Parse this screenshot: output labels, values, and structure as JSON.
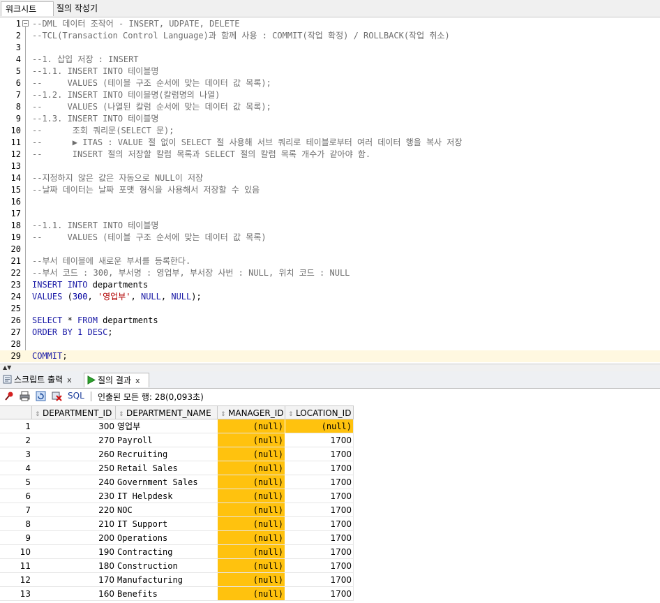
{
  "tabs": {
    "worksheet": "워크시트",
    "query_builder": "질의 작성기"
  },
  "editor": {
    "current_line": 29,
    "lines": [
      {
        "n": "1",
        "segs": [
          {
            "t": "--DML 데이터 조작어 - INSERT, UDPATE, DELETE",
            "c": "comment"
          }
        ]
      },
      {
        "n": "2",
        "segs": [
          {
            "t": "--TCL(Transaction Control Language)과 함께 사용 : COMMIT(작업 확정) / ROLLBACK(작업 취소)",
            "c": "comment"
          }
        ]
      },
      {
        "n": "3",
        "segs": []
      },
      {
        "n": "4",
        "segs": [
          {
            "t": "--1. 삽입 저장 : INSERT",
            "c": "comment"
          }
        ]
      },
      {
        "n": "5",
        "segs": [
          {
            "t": "--1.1. INSERT INTO 테이블명",
            "c": "comment"
          }
        ]
      },
      {
        "n": "6",
        "segs": [
          {
            "t": "--     VALUES (테이블 구조 순서에 맞는 데이터 값 목록);",
            "c": "comment"
          }
        ]
      },
      {
        "n": "7",
        "segs": [
          {
            "t": "--1.2. INSERT INTO 테이블명(칼럼명의 나열)",
            "c": "comment"
          }
        ]
      },
      {
        "n": "8",
        "segs": [
          {
            "t": "--     VALUES (나열된 칼럼 순서에 맞는 데이터 값 목록);",
            "c": "comment"
          }
        ]
      },
      {
        "n": "9",
        "segs": [
          {
            "t": "--1.3. INSERT INTO 테이블명",
            "c": "comment"
          }
        ]
      },
      {
        "n": "10",
        "segs": [
          {
            "t": "--      조회 쿼리문(SELECT 문);",
            "c": "comment"
          }
        ]
      },
      {
        "n": "11",
        "segs": [
          {
            "t": "--      ▶ ITAS : VALUE 절 없이 SELECT 절 사용해 서브 쿼리로 테이블로부터 여러 데이터 행을 복사 저장",
            "c": "comment"
          }
        ]
      },
      {
        "n": "12",
        "segs": [
          {
            "t": "--      INSERT 절의 저장할 칼럼 목록과 SELECT 절의 칼럼 목록 개수가 같아야 함.",
            "c": "comment"
          }
        ]
      },
      {
        "n": "13",
        "segs": []
      },
      {
        "n": "14",
        "segs": [
          {
            "t": "--지정하지 않은 값은 자동으로 NULL이 저장",
            "c": "comment"
          }
        ]
      },
      {
        "n": "15",
        "segs": [
          {
            "t": "--날짜 데이터는 날짜 포맷 형식을 사용해서 저장할 수 있음",
            "c": "comment"
          }
        ]
      },
      {
        "n": "16",
        "segs": []
      },
      {
        "n": "17",
        "segs": []
      },
      {
        "n": "18",
        "segs": [
          {
            "t": "--1.1. INSERT INTO 테이블명",
            "c": "comment"
          }
        ]
      },
      {
        "n": "19",
        "segs": [
          {
            "t": "--     VALUES (테이블 구조 순서에 맞는 데이터 값 목록)",
            "c": "comment"
          }
        ]
      },
      {
        "n": "20",
        "segs": []
      },
      {
        "n": "21",
        "segs": [
          {
            "t": "--부서 테이블에 새로운 부서를 등록한다.",
            "c": "comment"
          }
        ]
      },
      {
        "n": "22",
        "segs": [
          {
            "t": "--부서 코드 : 300, 부서명 : 영업부, 부서장 사번 : NULL, 위치 코드 : NULL",
            "c": "comment"
          }
        ]
      },
      {
        "n": "23",
        "segs": [
          {
            "t": "INSERT INTO ",
            "c": "kw"
          },
          {
            "t": "departments",
            "c": "plain"
          }
        ]
      },
      {
        "n": "24",
        "segs": [
          {
            "t": "VALUES ",
            "c": "kw"
          },
          {
            "t": "(",
            "c": "plain"
          },
          {
            "t": "300",
            "c": "num"
          },
          {
            "t": ", ",
            "c": "plain"
          },
          {
            "t": "'영업부'",
            "c": "str"
          },
          {
            "t": ", ",
            "c": "plain"
          },
          {
            "t": "NULL",
            "c": "kw"
          },
          {
            "t": ", ",
            "c": "plain"
          },
          {
            "t": "NULL",
            "c": "kw"
          },
          {
            "t": ");",
            "c": "plain"
          }
        ]
      },
      {
        "n": "25",
        "segs": []
      },
      {
        "n": "26",
        "segs": [
          {
            "t": "SELECT ",
            "c": "kw"
          },
          {
            "t": "* ",
            "c": "plain"
          },
          {
            "t": "FROM ",
            "c": "kw"
          },
          {
            "t": "departments",
            "c": "plain"
          }
        ]
      },
      {
        "n": "27",
        "segs": [
          {
            "t": "ORDER BY ",
            "c": "kw"
          },
          {
            "t": "1 ",
            "c": "num"
          },
          {
            "t": "DESC",
            "c": "kw"
          },
          {
            "t": ";",
            "c": "plain"
          }
        ]
      },
      {
        "n": "28",
        "segs": []
      },
      {
        "n": "29",
        "segs": [
          {
            "t": "COMMIT",
            "c": "kw"
          },
          {
            "t": ";",
            "c": "plain"
          }
        ]
      }
    ]
  },
  "result_tabs": {
    "script_output": "스크립트 출력",
    "query_result": "질의 결과",
    "close": "x"
  },
  "toolbar": {
    "sql_label": "SQL",
    "status": "인출된 모든 행: 28(0,093초)"
  },
  "grid": {
    "columns": [
      "DEPARTMENT_ID",
      "DEPARTMENT_NAME",
      "MANAGER_ID",
      "LOCATION_ID"
    ],
    "rows": [
      {
        "idx": "1",
        "id": "300",
        "name": "영업부",
        "mgr": "(null)",
        "loc": "(null)"
      },
      {
        "idx": "2",
        "id": "270",
        "name": "Payroll",
        "mgr": "(null)",
        "loc": "1700"
      },
      {
        "idx": "3",
        "id": "260",
        "name": "Recruiting",
        "mgr": "(null)",
        "loc": "1700"
      },
      {
        "idx": "4",
        "id": "250",
        "name": "Retail Sales",
        "mgr": "(null)",
        "loc": "1700"
      },
      {
        "idx": "5",
        "id": "240",
        "name": "Government Sales",
        "mgr": "(null)",
        "loc": "1700"
      },
      {
        "idx": "6",
        "id": "230",
        "name": "IT Helpdesk",
        "mgr": "(null)",
        "loc": "1700"
      },
      {
        "idx": "7",
        "id": "220",
        "name": "NOC",
        "mgr": "(null)",
        "loc": "1700"
      },
      {
        "idx": "8",
        "id": "210",
        "name": "IT Support",
        "mgr": "(null)",
        "loc": "1700"
      },
      {
        "idx": "9",
        "id": "200",
        "name": "Operations",
        "mgr": "(null)",
        "loc": "1700"
      },
      {
        "idx": "10",
        "id": "190",
        "name": "Contracting",
        "mgr": "(null)",
        "loc": "1700"
      },
      {
        "idx": "11",
        "id": "180",
        "name": "Construction",
        "mgr": "(null)",
        "loc": "1700"
      },
      {
        "idx": "12",
        "id": "170",
        "name": "Manufacturing",
        "mgr": "(null)",
        "loc": "1700"
      },
      {
        "idx": "13",
        "id": "160",
        "name": "Benefits",
        "mgr": "(null)",
        "loc": "1700"
      }
    ]
  },
  "colors": {
    "null_highlight": "#ffc20e",
    "keyword": "#1a1aa6",
    "comment": "#6d6d6d",
    "string": "#b00000"
  }
}
